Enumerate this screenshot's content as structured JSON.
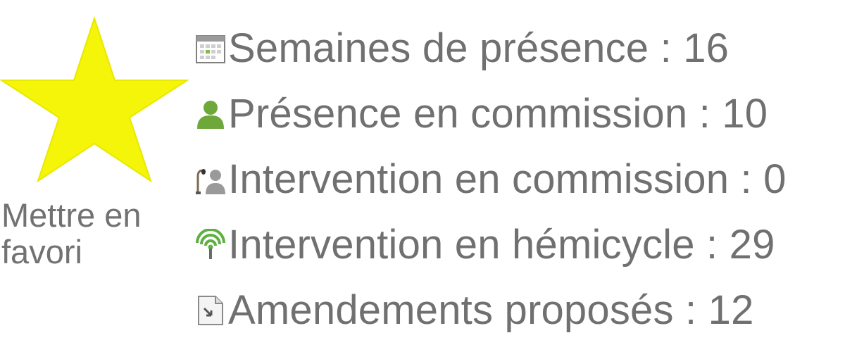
{
  "favorite": {
    "label": "Mettre en favori",
    "icon": "star-icon",
    "star_color": "#f5f50a"
  },
  "stats": [
    {
      "icon": "calendar-icon",
      "label": "Semaines de présence : 16"
    },
    {
      "icon": "person-icon",
      "label": "Présence en commission : 10"
    },
    {
      "icon": "microphone-person-icon",
      "label": "Intervention en commission : 0"
    },
    {
      "icon": "broadcast-antenna-icon",
      "label": "Intervention en hémicycle : 29"
    },
    {
      "icon": "document-icon",
      "label": "Amendements proposés : 12"
    }
  ],
  "colors": {
    "text": "#707070",
    "person_green": "#6fa83a",
    "antenna_green": "#5fb043"
  }
}
